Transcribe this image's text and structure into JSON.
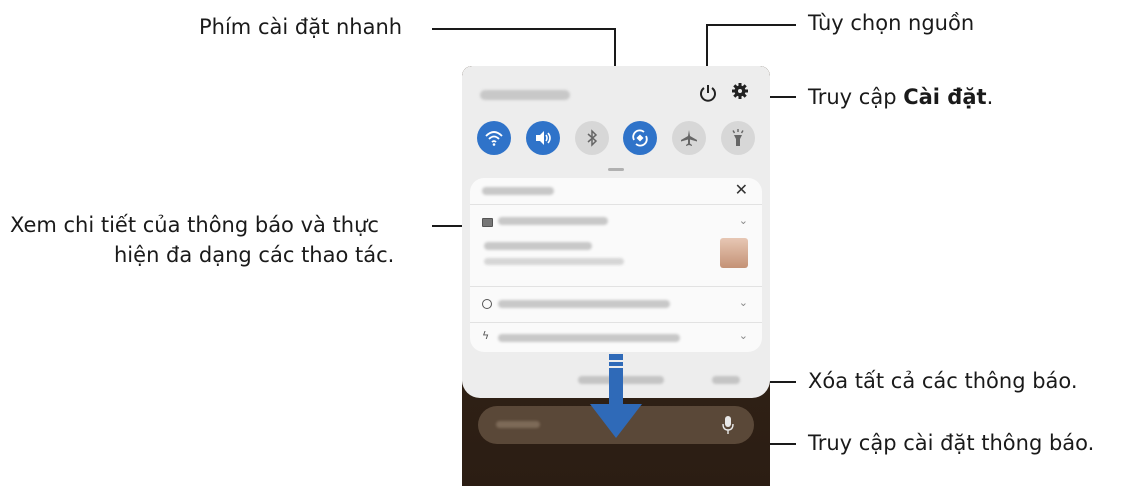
{
  "callouts": {
    "quick_settings": "Phím cài đặt nhanh",
    "power_options": "Tùy chọn nguồn",
    "access_settings_prefix": "Truy cập ",
    "access_settings_bold": "Cài đặt",
    "access_settings_suffix": ".",
    "notification_details_line1": "Xem chi tiết của thông báo và thực",
    "notification_details_line2": "hiện đa dạng các thao tác.",
    "clear_all": "Xóa tất cả các thông báo.",
    "notification_settings": "Truy cập cài đặt thông báo."
  },
  "panel": {
    "icons": {
      "power": "power-icon",
      "settings": "gear-icon",
      "close": "close-icon",
      "mic": "mic-icon"
    },
    "quick_tiles": [
      {
        "name": "wifi-icon",
        "state": "on"
      },
      {
        "name": "sound-icon",
        "state": "on"
      },
      {
        "name": "bluetooth-icon",
        "state": "off"
      },
      {
        "name": "auto-rotate-icon",
        "state": "on"
      },
      {
        "name": "airplane-icon",
        "state": "off"
      },
      {
        "name": "flashlight-icon",
        "state": "off"
      }
    ],
    "notification_rows": [
      {
        "icon": "image-icon",
        "state": "expanded"
      },
      {
        "icon": "app-icon",
        "state": "collapsed"
      },
      {
        "icon": "lightning-icon",
        "state": "collapsed"
      }
    ],
    "colors": {
      "tile_on": "#2f73c9",
      "tile_off": "#d7d7d7",
      "swipe_arrow": "#2f6ab8"
    }
  }
}
